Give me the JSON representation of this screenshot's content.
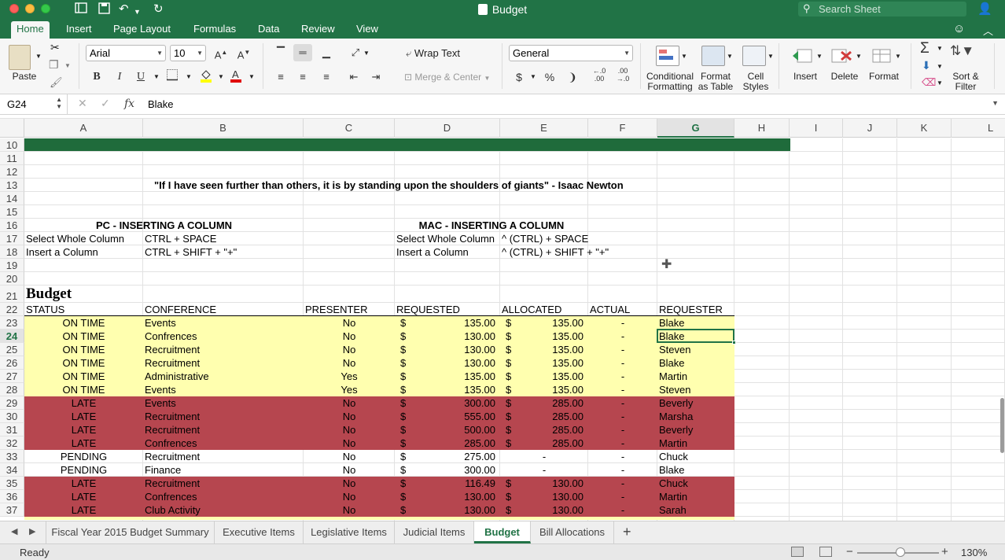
{
  "window": {
    "title": "Budget",
    "search_placeholder": "Search Sheet"
  },
  "ribbon_tabs": [
    "Home",
    "Insert",
    "Page Layout",
    "Formulas",
    "Data",
    "Review",
    "View"
  ],
  "ribbon": {
    "paste_label": "Paste",
    "font_name": "Arial",
    "font_size": "10",
    "wrap_text_label": "Wrap Text",
    "merge_center_label": "Merge & Center",
    "number_format": "General",
    "conditional_formatting_label": "Conditional Formatting",
    "format_as_table_label": "Format as Table",
    "cell_styles_label": "Cell Styles",
    "insert_label": "Insert",
    "delete_label": "Delete",
    "format_label": "Format",
    "sort_filter_label": "Sort & Filter",
    "bold_label": "B",
    "italic_label": "I",
    "underline_label": "U",
    "currency_label": "$",
    "percent_label": "%",
    "comma_label": "❩",
    "inc_decimal_label": "←.0\n.00",
    "dec_decimal_label": ".00\n→.0"
  },
  "formula_bar": {
    "name_box": "G24",
    "formula": "Blake"
  },
  "columns": [
    "A",
    "B",
    "C",
    "D",
    "E",
    "F",
    "G",
    "H",
    "I",
    "J",
    "K",
    "L"
  ],
  "selected_column": "G",
  "selected_row": "24",
  "rows": [
    "10",
    "11",
    "12",
    "13",
    "14",
    "15",
    "16",
    "17",
    "18",
    "19",
    "20",
    "21",
    "22",
    "23",
    "24",
    "25",
    "26",
    "27",
    "28",
    "29",
    "30",
    "31",
    "32",
    "33",
    "34",
    "35",
    "36",
    "37"
  ],
  "quote": "\"If I have seen further than others, it is by standing upon the shoulders of giants\" - Isaac Newton",
  "pc_section": {
    "title": "PC - INSERTING A COLUMN",
    "rows": [
      {
        "action": "Select Whole Column",
        "keys": "CTRL + SPACE"
      },
      {
        "action": "Insert a Column",
        "keys": "CTRL + SHIFT + \"+\""
      }
    ]
  },
  "mac_section": {
    "title": "MAC - INSERTING A COLUMN",
    "rows": [
      {
        "action": "Select Whole Column",
        "keys": "^ (CTRL) + SPACE"
      },
      {
        "action": "Insert a Column",
        "keys": "^ (CTRL) + SHIFT + \"+\""
      }
    ]
  },
  "budget": {
    "title": "Budget",
    "headers": [
      "STATUS",
      "CONFERENCE",
      "PRESENTER",
      "REQUESTED",
      "ALLOCATED",
      "ACTUAL",
      "REQUESTER"
    ],
    "rows": [
      {
        "status": "ON TIME",
        "conference": "Events",
        "presenter": "No",
        "requested_sym": "$",
        "requested": "135.00",
        "allocated_sym": "$",
        "allocated": "135.00",
        "actual": "-",
        "requester": "Blake",
        "band": "yellow"
      },
      {
        "status": "ON TIME",
        "conference": "Confrences",
        "presenter": "No",
        "requested_sym": "$",
        "requested": "130.00",
        "allocated_sym": "$",
        "allocated": "135.00",
        "actual": "-",
        "requester": "Blake",
        "band": "yellow"
      },
      {
        "status": "ON TIME",
        "conference": "Recruitment",
        "presenter": "No",
        "requested_sym": "$",
        "requested": "130.00",
        "allocated_sym": "$",
        "allocated": "135.00",
        "actual": "-",
        "requester": "Steven",
        "band": "yellow"
      },
      {
        "status": "ON TIME",
        "conference": "Recruitment",
        "presenter": "No",
        "requested_sym": "$",
        "requested": "130.00",
        "allocated_sym": "$",
        "allocated": "135.00",
        "actual": "-",
        "requester": "Blake",
        "band": "yellow"
      },
      {
        "status": "ON TIME",
        "conference": "Administrative",
        "presenter": "Yes",
        "requested_sym": "$",
        "requested": "135.00",
        "allocated_sym": "$",
        "allocated": "135.00",
        "actual": "-",
        "requester": "Martin",
        "band": "yellow"
      },
      {
        "status": "ON TIME",
        "conference": "Events",
        "presenter": "Yes",
        "requested_sym": "$",
        "requested": "135.00",
        "allocated_sym": "$",
        "allocated": "135.00",
        "actual": "-",
        "requester": "Steven",
        "band": "yellow"
      },
      {
        "status": "LATE",
        "conference": "Events",
        "presenter": "No",
        "requested_sym": "$",
        "requested": "300.00",
        "allocated_sym": "$",
        "allocated": "285.00",
        "actual": "-",
        "requester": "Beverly",
        "band": "red"
      },
      {
        "status": "LATE",
        "conference": "Recruitment",
        "presenter": "No",
        "requested_sym": "$",
        "requested": "555.00",
        "allocated_sym": "$",
        "allocated": "285.00",
        "actual": "-",
        "requester": "Marsha",
        "band": "red"
      },
      {
        "status": "LATE",
        "conference": "Recruitment",
        "presenter": "No",
        "requested_sym": "$",
        "requested": "500.00",
        "allocated_sym": "$",
        "allocated": "285.00",
        "actual": "-",
        "requester": "Beverly",
        "band": "red"
      },
      {
        "status": "LATE",
        "conference": "Confrences",
        "presenter": "No",
        "requested_sym": "$",
        "requested": "285.00",
        "allocated_sym": "$",
        "allocated": "285.00",
        "actual": "-",
        "requester": "Martin",
        "band": "red"
      },
      {
        "status": "PENDING",
        "conference": "Recruitment",
        "presenter": "No",
        "requested_sym": "$",
        "requested": "275.00",
        "allocated_sym": "",
        "allocated": "-",
        "actual": "-",
        "requester": "Chuck",
        "band": "white"
      },
      {
        "status": "PENDING",
        "conference": "Finance",
        "presenter": "No",
        "requested_sym": "$",
        "requested": "300.00",
        "allocated_sym": "",
        "allocated": "-",
        "actual": "-",
        "requester": "Blake",
        "band": "white"
      },
      {
        "status": "LATE",
        "conference": "Recruitment",
        "presenter": "No",
        "requested_sym": "$",
        "requested": "116.49",
        "allocated_sym": "$",
        "allocated": "130.00",
        "actual": "-",
        "requester": "Chuck",
        "band": "red"
      },
      {
        "status": "LATE",
        "conference": "Confrences",
        "presenter": "No",
        "requested_sym": "$",
        "requested": "130.00",
        "allocated_sym": "$",
        "allocated": "130.00",
        "actual": "-",
        "requester": "Martin",
        "band": "red"
      },
      {
        "status": "LATE",
        "conference": "Club Activity",
        "presenter": "No",
        "requested_sym": "$",
        "requested": "130.00",
        "allocated_sym": "$",
        "allocated": "130.00",
        "actual": "-",
        "requester": "Sarah",
        "band": "red"
      }
    ]
  },
  "sheet_tabs": [
    "Fiscal Year 2015 Budget Summary",
    "Executive Items",
    "Legislative Items",
    "Judicial Items",
    "Budget",
    "Bill Allocations"
  ],
  "active_sheet": "Budget",
  "status": {
    "text": "Ready",
    "zoom": "130%"
  },
  "colors": {
    "accent": "#217346",
    "band_yellow": "#ffffaf",
    "band_red": "#b6464f",
    "header_bar": "#1f6b3b"
  }
}
